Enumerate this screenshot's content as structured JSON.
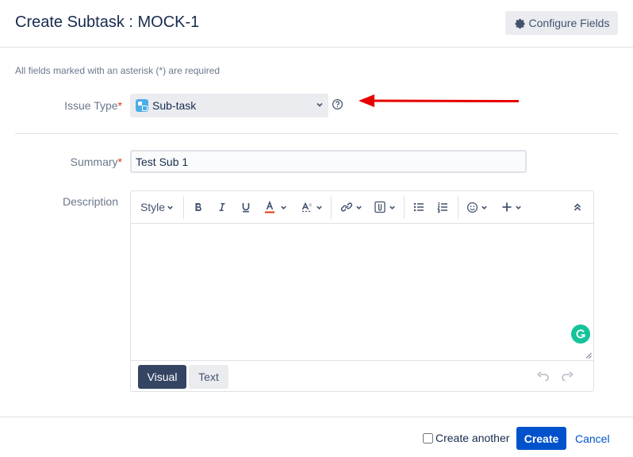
{
  "dialog": {
    "title": "Create Subtask : MOCK-1",
    "configure_fields_label": "Configure Fields",
    "required_note": "All fields marked with an asterisk (*) are required"
  },
  "fields": {
    "issue_type": {
      "label": "Issue Type",
      "asterisk": "*",
      "value": "Sub-task"
    },
    "summary": {
      "label": "Summary",
      "asterisk": "*",
      "value": "Test Sub 1"
    },
    "description": {
      "label": "Description"
    }
  },
  "editor": {
    "style_label": "Style",
    "tabs": {
      "visual": "Visual",
      "text": "Text"
    },
    "active_tab": "Visual",
    "icons": [
      "bold-icon",
      "italic-icon",
      "underline-icon",
      "text-color-icon",
      "text-effects-icon",
      "link-icon",
      "attachment-icon",
      "bullet-list-icon",
      "numbered-list-icon",
      "emoji-icon",
      "insert-icon",
      "collapse-icon",
      "undo-icon",
      "redo-icon",
      "grammarly-icon"
    ]
  },
  "footer": {
    "create_another_label": "Create another",
    "create_another_checked": false,
    "create_label": "Create",
    "cancel_label": "Cancel"
  },
  "colors": {
    "primary": "#0052cc",
    "annotation_arrow": "#e60000",
    "required_asterisk": "#de350b",
    "grammarly": "#15c39a",
    "visual_tab": "#344563"
  }
}
